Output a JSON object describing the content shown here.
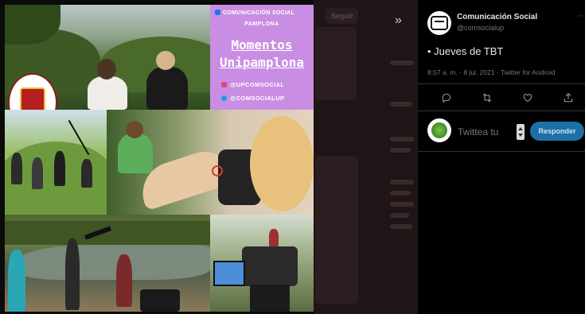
{
  "media": {
    "brand_header": "COMUNICACIÓN SOCIAL",
    "brand_sub": "PAMPLONA",
    "title_line1": "Momentos",
    "title_line2": "Unipamplona",
    "instagram_handle": "@UPCOMSOCIAL",
    "twitter_handle": "@COMSOCIALUP",
    "brand_bg_color": "#c98ee3"
  },
  "background": {
    "follow_button": "Seguir"
  },
  "tweet": {
    "author_name": "Comunicación Social",
    "author_handle": "@comsocialup",
    "more_label": "···",
    "text": "• Jueves de TBT",
    "meta": "8:57 a. m. · 8 jul. 2021 · Twitter for Android"
  },
  "reply": {
    "placeholder": "Twittea tu",
    "button_label": "Responder"
  },
  "colors": {
    "accent": "#1d9bf0",
    "panel_bg": "#000000",
    "muted_text": "#71767b"
  }
}
